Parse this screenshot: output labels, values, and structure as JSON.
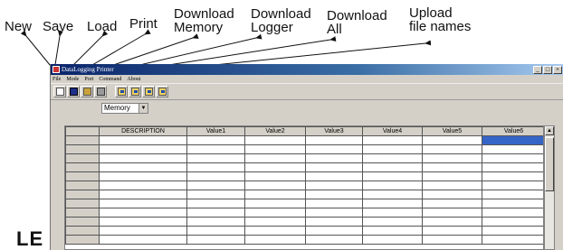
{
  "callouts": {
    "new": "New",
    "save": "Save",
    "load": "Load",
    "print": "Print",
    "download_memory": [
      "Download",
      "Memory"
    ],
    "download_logger": [
      "Download",
      "Logger"
    ],
    "download_all": [
      "Download",
      "All"
    ],
    "upload_file_names": [
      "Upload",
      "file names"
    ]
  },
  "partial_heading": "LE",
  "window": {
    "title": "DataLogging Printer",
    "controls": {
      "minimize": "_",
      "maximize": "□",
      "close": "×"
    }
  },
  "menubar": [
    "File",
    "Mode",
    "Port",
    "Command",
    "About"
  ],
  "toolbar": {
    "icons": [
      "new-icon",
      "save-icon",
      "load-icon",
      "print-icon",
      "download-memory-icon",
      "download-logger-icon",
      "download-all-icon",
      "upload-file-names-icon"
    ]
  },
  "mode_select": {
    "value": "Memory",
    "arrow": "▼"
  },
  "grid": {
    "columns": [
      "",
      "DESCRIPTION",
      "Value1",
      "Value2",
      "Value3",
      "Value4",
      "Value5",
      "Value6"
    ],
    "rows": [
      [
        "",
        "",
        "",
        "",
        "",
        "",
        "",
        ""
      ],
      [
        "",
        "",
        "",
        "",
        "",
        "",
        "",
        ""
      ],
      [
        "",
        "",
        "",
        "",
        "",
        "",
        "",
        ""
      ],
      [
        "",
        "",
        "",
        "",
        "",
        "",
        "",
        ""
      ],
      [
        "",
        "",
        "",
        "",
        "",
        "",
        "",
        ""
      ],
      [
        "",
        "",
        "",
        "",
        "",
        "",
        "",
        ""
      ],
      [
        "",
        "",
        "",
        "",
        "",
        "",
        "",
        ""
      ],
      [
        "",
        "",
        "",
        "",
        "",
        "",
        "",
        ""
      ],
      [
        "",
        "",
        "",
        "",
        "",
        "",
        "",
        ""
      ],
      [
        "",
        "",
        "",
        "",
        "",
        "",
        "",
        ""
      ],
      [
        "",
        "",
        "",
        "",
        "",
        "",
        "",
        ""
      ],
      [
        "",
        "",
        "",
        "",
        "",
        "",
        "",
        ""
      ]
    ],
    "selected_cell": {
      "row": 0,
      "col": 7
    }
  },
  "scrollbar": {
    "up_arrow": "▲"
  }
}
